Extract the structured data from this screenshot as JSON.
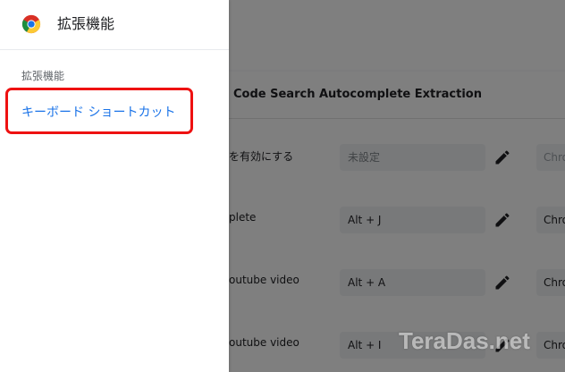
{
  "drawer": {
    "title": "拡張機能",
    "section_label": "拡張機能",
    "selected_item": "キーボード ショートカット"
  },
  "background": {
    "card_title": "Code Search Autocomplete Extraction",
    "rows": [
      {
        "label": "を有効にする",
        "shortcut": "未設定",
        "scope": "Chro"
      },
      {
        "label": "plete",
        "shortcut": "Alt + J",
        "scope": "Chro"
      },
      {
        "label": "outube video",
        "shortcut": "Alt + A",
        "scope": "Chro"
      },
      {
        "label": "outube video",
        "shortcut": "Alt + I",
        "scope": "Chro"
      }
    ]
  },
  "watermark": "TeraDas.net",
  "colors": {
    "accent": "#1a73e8",
    "highlight": "#ee1111",
    "scrim": "rgba(0,0,0,0.5)"
  }
}
